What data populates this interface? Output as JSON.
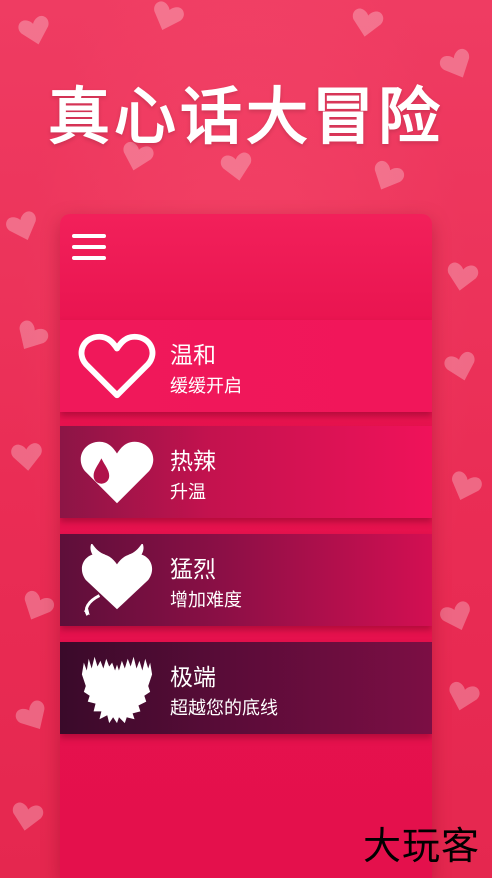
{
  "app": {
    "title": "真心话大冒险"
  },
  "menu": {
    "icon": "hamburger-menu-icon"
  },
  "levels": [
    {
      "name": "温和",
      "desc": "缓缓开启",
      "icon": "outline-heart-icon"
    },
    {
      "name": "热辣",
      "desc": "升温",
      "icon": "drop-heart-icon"
    },
    {
      "name": "猛烈",
      "desc": "增加难度",
      "icon": "devil-heart-icon"
    },
    {
      "name": "极端",
      "desc": "超越您的底线",
      "icon": "jagged-heart-icon"
    }
  ],
  "watermark": "大玩客",
  "colors": {
    "background": "#ef3c62",
    "panel": "#e8134f",
    "text": "#ffffff"
  }
}
